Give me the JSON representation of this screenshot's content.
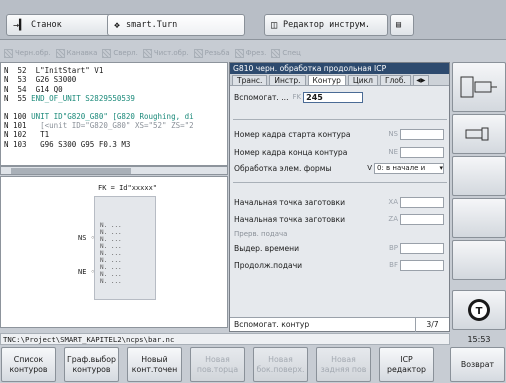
{
  "top_tabs": [
    {
      "label": "Станок"
    },
    {
      "label": "smart.Turn"
    },
    {
      "label": "Редактор инструм."
    }
  ],
  "menu_strip": [
    "Черн.обр.",
    "Канавка",
    "Сверл.",
    "Чист.обр.",
    "Резьба",
    "Фрез.",
    "Спец"
  ],
  "program": {
    "lines_a": [
      {
        "n": "N  52",
        "text": "  L\"InitStart\" V1"
      },
      {
        "n": "N  53",
        "text": "  G26 S3000"
      },
      {
        "n": "N  54",
        "text": "  G14 Q0"
      },
      {
        "n": "N  55",
        "text": " END_OF_UNIT S2829550539"
      }
    ],
    "lines_b": [
      {
        "n": "N 100",
        "text": " UNIT ID\"G820_G80\" [G820 Roughing, di"
      },
      {
        "n": "N 101",
        "text": "   [<unit ID=\"G820_G80\" XS=\"52\" ZS=\"2"
      },
      {
        "n": "N 102",
        "text": "   T1"
      },
      {
        "n": "N 103",
        "text": "   G96 S300 G95 F0.3 M3"
      }
    ]
  },
  "graphic": {
    "fk": "FK = Id\"xxxxx\"",
    "ns": "NS",
    "ne": "NE",
    "n_placeholder": "N. ..."
  },
  "dialog": {
    "title": "G810 черн. обработка продольная ICP",
    "tabs": [
      "Транс.",
      "Инстр.",
      "Контур",
      "Цикл",
      "Глоб."
    ],
    "active_tab": "Контур",
    "fields": {
      "aux_label": "Вспомогат. ...",
      "aux_unit": "FK",
      "aux_value": "245",
      "ns_label": "Номер кадра старта контура",
      "ns_unit": "NS",
      "ne_label": "Номер кадра конца контура",
      "ne_unit": "NE",
      "form_label": "Обработка элем. формы",
      "form_unit": "V",
      "form_value": "0: в начале и",
      "xa_label": "Начальная точка заготовки",
      "xa_unit": "XA",
      "za_label": "Начальная точка заготовки",
      "za_unit": "ZA",
      "group_label": "Прерв. подача",
      "bp_label": "Выдер. времени",
      "bp_unit": "BP",
      "bf_label": "Продолж.подачи",
      "bf_unit": "BF"
    },
    "status_text": "Вспомогат. контур",
    "page": "3/7"
  },
  "path": "TNC:\\Project\\SMART_KAPITEL2\\ncps\\bar.nc",
  "clock": "15:53",
  "bottom_softkeys": [
    {
      "label": "Список контуров",
      "enabled": true
    },
    {
      "label": "Граф.выбор контуров",
      "enabled": true
    },
    {
      "label": "Новый конт.точен",
      "enabled": true
    },
    {
      "label": "Новая пов.торца",
      "enabled": false
    },
    {
      "label": "Новая бок.поверх.",
      "enabled": false
    },
    {
      "label": "Новая задняя пов",
      "enabled": false
    },
    {
      "label": "ICP редактор",
      "enabled": true
    },
    {
      "label": "Возврат",
      "enabled": true
    }
  ],
  "colors": {
    "title_bg": "#2d4a6e",
    "code_blue": "#1a56b0",
    "code_teal": "#1b8a7a"
  }
}
